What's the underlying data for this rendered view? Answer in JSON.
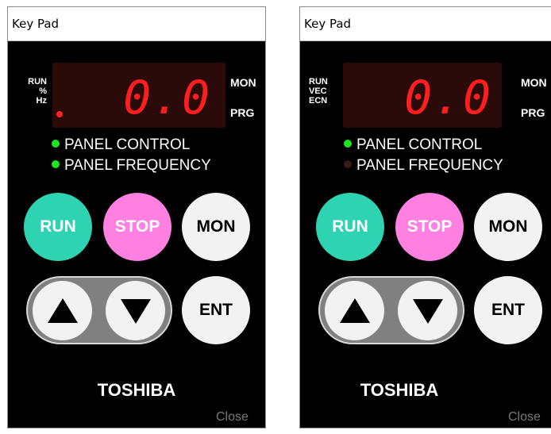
{
  "panels": [
    {
      "title": "Key Pad",
      "indicators": [
        "RUN",
        "%",
        "Hz"
      ],
      "display_value": "0.0",
      "mode_labels": {
        "top": "MON",
        "bottom": "PRG"
      },
      "status": [
        {
          "label": "PANEL CONTROL",
          "led": "on"
        },
        {
          "label": "PANEL FREQUENCY",
          "led": "on"
        }
      ],
      "buttons": {
        "run": "RUN",
        "stop": "STOP",
        "mon": "MON",
        "ent": "ENT"
      },
      "brand": "TOSHIBA",
      "close_label": "Close"
    },
    {
      "title": "Key Pad",
      "indicators": [
        "RUN",
        "VEC",
        "ECN"
      ],
      "display_value": "0.0",
      "mode_labels": {
        "top": "MON",
        "bottom": "PRG"
      },
      "status": [
        {
          "label": "PANEL CONTROL",
          "led": "on"
        },
        {
          "label": "PANEL FREQUENCY",
          "led": "off"
        }
      ],
      "buttons": {
        "run": "RUN",
        "stop": "STOP",
        "mon": "MON",
        "ent": "ENT"
      },
      "brand": "TOSHIBA",
      "close_label": "Close"
    }
  ],
  "colors": {
    "run_button": "#2ed3b1",
    "stop_button": "#ff80e0",
    "display_digits": "#ff1e1e",
    "led_on": "#1ee51e",
    "led_off": "#3a1a14"
  },
  "icons": [
    "up-arrow-icon",
    "down-arrow-icon",
    "led-icon"
  ]
}
